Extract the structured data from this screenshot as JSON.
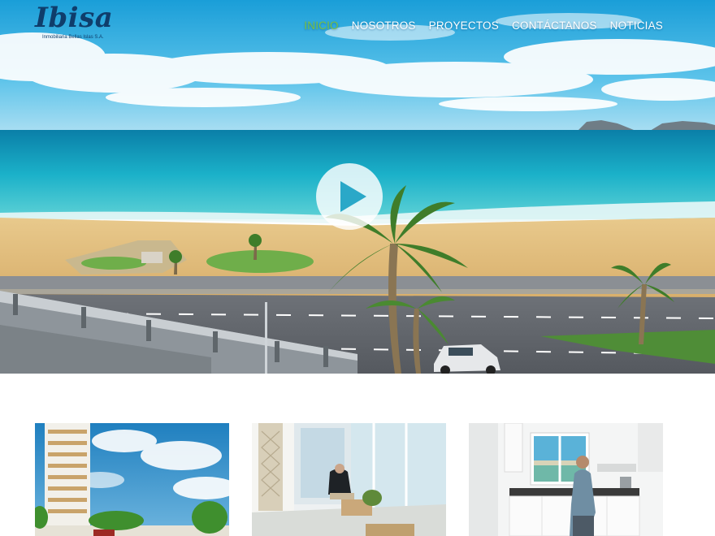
{
  "logo": {
    "text": "Ibisa",
    "subtitle": "Inmobiliaria Bellas Islas S.A."
  },
  "nav": {
    "items": [
      {
        "label": "INICIO",
        "active": true
      },
      {
        "label": "NOSOTROS",
        "active": false
      },
      {
        "label": "PROYECTOS",
        "active": false
      },
      {
        "label": "CONTÁCTANOS",
        "active": false
      },
      {
        "label": "NOTICIAS",
        "active": false
      }
    ]
  },
  "hero": {
    "play_icon": "play-icon"
  },
  "colors": {
    "nav_active": "#7ac143",
    "nav_text": "#ffffff",
    "logo": "#0f3d6b",
    "play": "#2aa8c8"
  },
  "cards": [
    {
      "name": "building-exterior"
    },
    {
      "name": "living-room-interior"
    },
    {
      "name": "kitchen-interior"
    }
  ]
}
